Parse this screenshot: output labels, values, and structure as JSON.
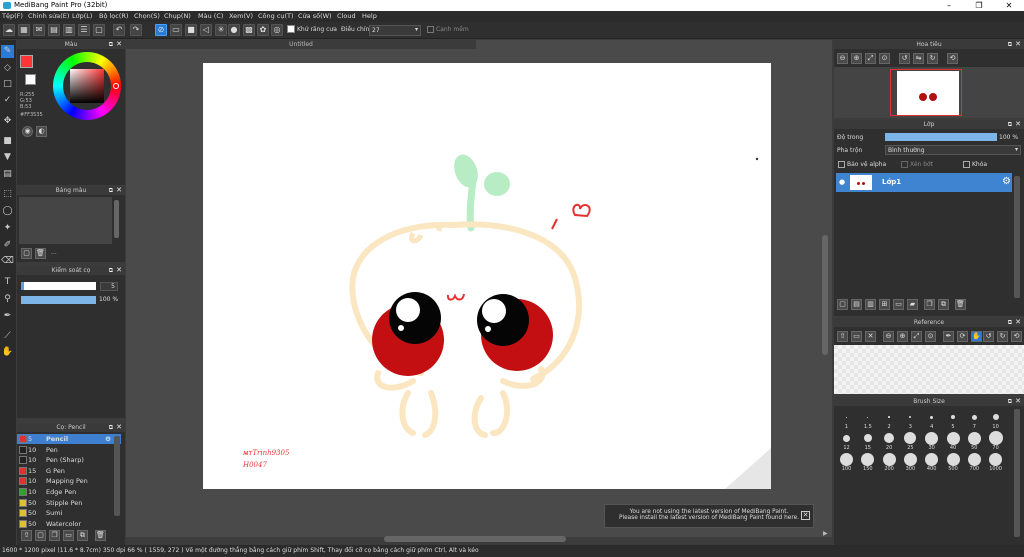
{
  "window": {
    "title": "MediBang Paint Pro (32bit)",
    "min": "–",
    "max": "❐",
    "close": "✕"
  },
  "menu": [
    "Tệp(F)",
    "Chỉnh sửa(E)",
    "Lớp(L)",
    "Bộ lọc(R)",
    "Chọn(S)",
    "Chụp(N)",
    "Màu (C)",
    "Xem(V)",
    "Công cụ(T)",
    "Cửa số(W)",
    "Cloud",
    "Help"
  ],
  "toolbar": {
    "antialias_label": "Khử răng cưa",
    "adjust_label": "Điều chỉnh",
    "adjust_value": "27",
    "smooth_label": "Cạnh mềm"
  },
  "color_panel": {
    "title": "Màu",
    "r": "R:255",
    "g": "G:53",
    "b": "B:53",
    "hex": "#FF3535",
    "current_color": "#ff3535"
  },
  "palette_panel": {
    "title": "Bảng màu",
    "more": "..."
  },
  "control_panel": {
    "title": "Kiểm soát cọ",
    "size_value": "5",
    "opacity_value": "100 %",
    "opacity_level": 1.0
  },
  "brush_panel": {
    "title": "Cọ: Pencil",
    "items": [
      {
        "size": "5",
        "name": "Pencil",
        "color": "#e03030",
        "selected": true
      },
      {
        "size": "10",
        "name": "Pen",
        "color": "#222222",
        "selected": false
      },
      {
        "size": "10",
        "name": "Pen (Sharp)",
        "color": "#222222",
        "selected": false
      },
      {
        "size": "15",
        "name": "G Pen",
        "color": "#e03030",
        "selected": false
      },
      {
        "size": "10",
        "name": "Mapping Pen",
        "color": "#e03030",
        "selected": false
      },
      {
        "size": "10",
        "name": "Edge Pen",
        "color": "#30a030",
        "selected": false
      },
      {
        "size": "50",
        "name": "Stipple Pen",
        "color": "#e0c030",
        "selected": false
      },
      {
        "size": "50",
        "name": "Sumi",
        "color": "#e0c030",
        "selected": false
      },
      {
        "size": "50",
        "name": "Watercolor",
        "color": "#e0c030",
        "selected": false
      }
    ]
  },
  "canvas": {
    "tab_title": "Untitled",
    "signature_line1": "ᴍ̶ᴛTrinh9305",
    "signature_line2": "H0047"
  },
  "navigator": {
    "title": "Hoa tiêu"
  },
  "layer_panel": {
    "title": "Lớp",
    "opacity_label": "Độ trong",
    "opacity_value": "100 %",
    "opacity_level": 1.0,
    "blend_label": "Pha trộn",
    "blend_value": "Bình thường",
    "protect_alpha": "Bảo vệ alpha",
    "clipping": "Xén bớt",
    "lock": "Khóa",
    "layers": [
      {
        "name": "Lớp1"
      }
    ]
  },
  "reference_panel": {
    "title": "Reference"
  },
  "brush_size_panel": {
    "title": "Brush Size",
    "sizes": [
      "1",
      "1.5",
      "2",
      "3",
      "4",
      "5",
      "7",
      "10",
      "12",
      "15",
      "20",
      "25",
      "30",
      "40",
      "50",
      "70",
      "100",
      "150",
      "200",
      "300",
      "400",
      "500",
      "700",
      "1000"
    ]
  },
  "notification": {
    "line1": "You are not using the latest version of MediBang Paint.",
    "line2": "Please install the latest version of MediBang Paint found here."
  },
  "status": {
    "text": "1600 * 1200 pixel   (11.6 * 8.7cm)   350 dpi   66 %   ( 1559, 272 )   Vẽ một đường thẳng bằng cách giữ phím Shift, Thay đổi cỡ cọ bằng cách giữ phím Ctrl, Alt và kéo"
  }
}
